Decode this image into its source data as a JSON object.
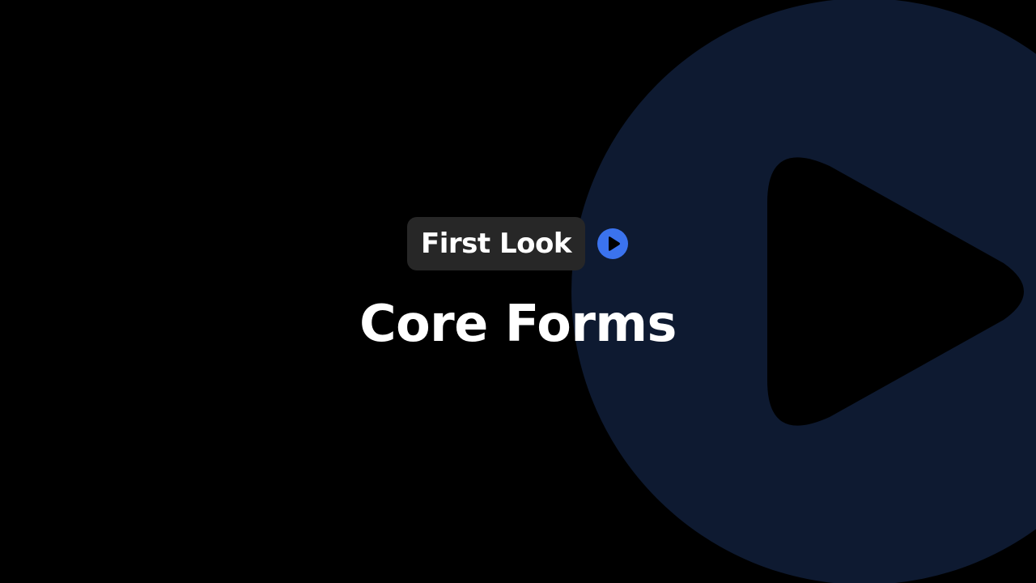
{
  "badge": {
    "label": "First Look"
  },
  "title": "Core Forms",
  "icons": {
    "badge_icon": "play-circle-icon",
    "background_icon": "play-icon"
  },
  "colors": {
    "background": "#000000",
    "badge_background": "#272727",
    "accent_blue": "#3b73ee",
    "background_play_circle": "#0e1a31",
    "text": "#ffffff"
  }
}
